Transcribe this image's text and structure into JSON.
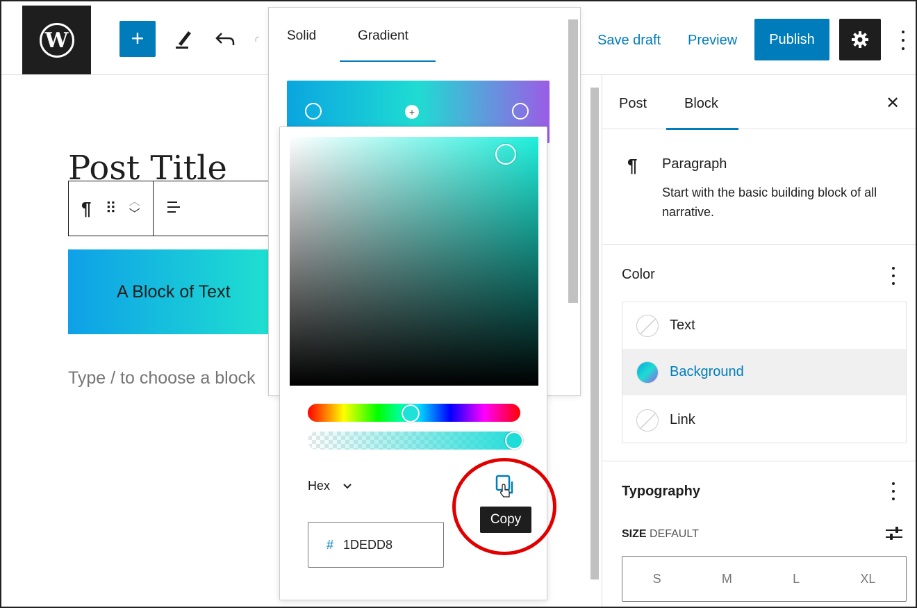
{
  "header": {
    "save_draft": "Save draft",
    "preview": "Preview",
    "publish": "Publish"
  },
  "canvas": {
    "post_title": "Post Title",
    "block_text": "A Block of Text",
    "placeholder": "Type / to choose a block"
  },
  "gradient_popover": {
    "tabs": [
      "Solid",
      "Gradient"
    ],
    "active_tab": "Gradient"
  },
  "color_picker": {
    "format": "Hex",
    "hex_prefix": "#",
    "hex_value": "1DEDD8",
    "copy_tooltip": "Copy"
  },
  "sidebar": {
    "tabs": [
      "Post",
      "Block"
    ],
    "active_tab": "Block",
    "block": {
      "name": "Paragraph",
      "description": "Start with the basic building block of all narrative."
    },
    "color_panel": {
      "title": "Color",
      "items": [
        "Text",
        "Background",
        "Link"
      ],
      "selected": "Background"
    },
    "typography_panel": {
      "title": "Typography",
      "size_label": "SIZE",
      "size_value": "DEFAULT",
      "sizes": [
        "S",
        "M",
        "L",
        "XL"
      ]
    }
  },
  "colors": {
    "accent": "#007cba",
    "highlight_ring": "#e00000",
    "gradient_start": "#0aa5e0",
    "gradient_mid": "#1fdcd2",
    "gradient_end": "#9b5ce6"
  }
}
